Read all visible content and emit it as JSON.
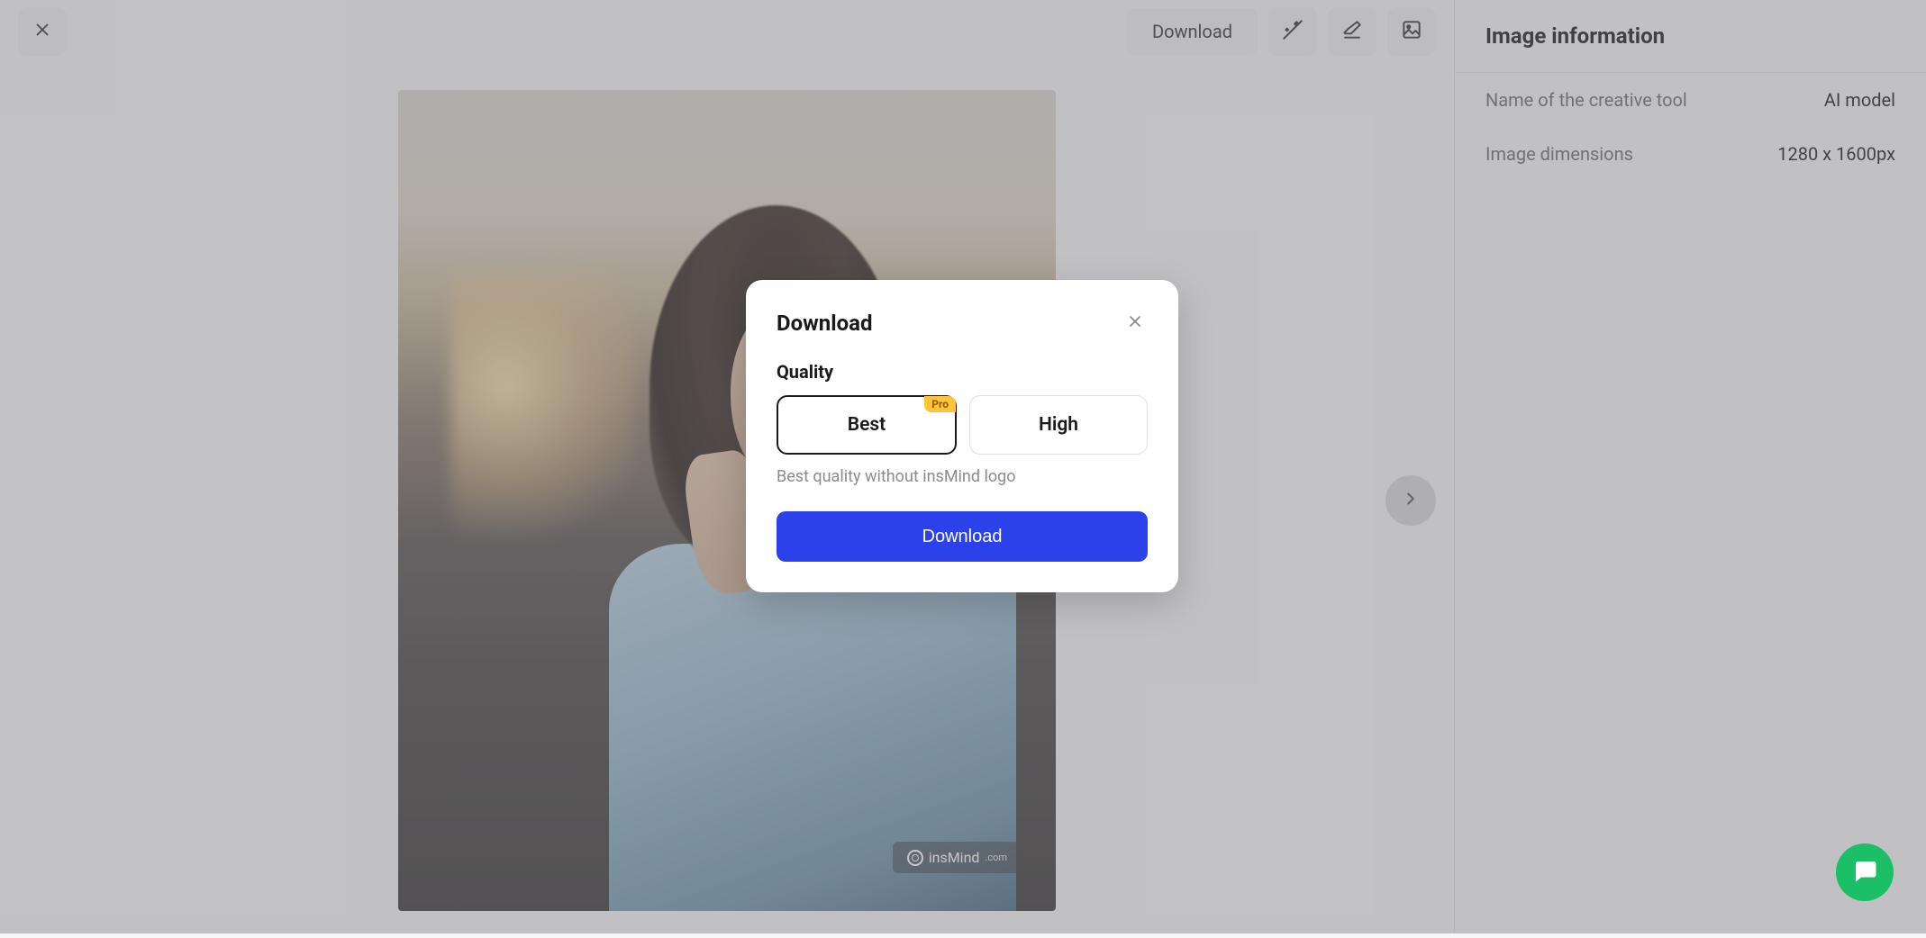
{
  "toolbar": {
    "download_label": "Download"
  },
  "watermark": {
    "brand": "insMind",
    "suffix": ".com"
  },
  "sidebar": {
    "title": "Image information",
    "creative_tool_label": "Name of the creative tool",
    "creative_tool_value": "AI model",
    "dimensions_label": "Image dimensions",
    "dimensions_value": "1280 x 1600px"
  },
  "modal": {
    "title": "Download",
    "quality_label": "Quality",
    "option_best": "Best",
    "option_best_badge": "Pro",
    "option_high": "High",
    "description": "Best quality without insMind logo",
    "download_button": "Download"
  },
  "colors": {
    "primary": "#2b42ea",
    "badge": "#ffc43a",
    "fab": "#1bbf66"
  }
}
